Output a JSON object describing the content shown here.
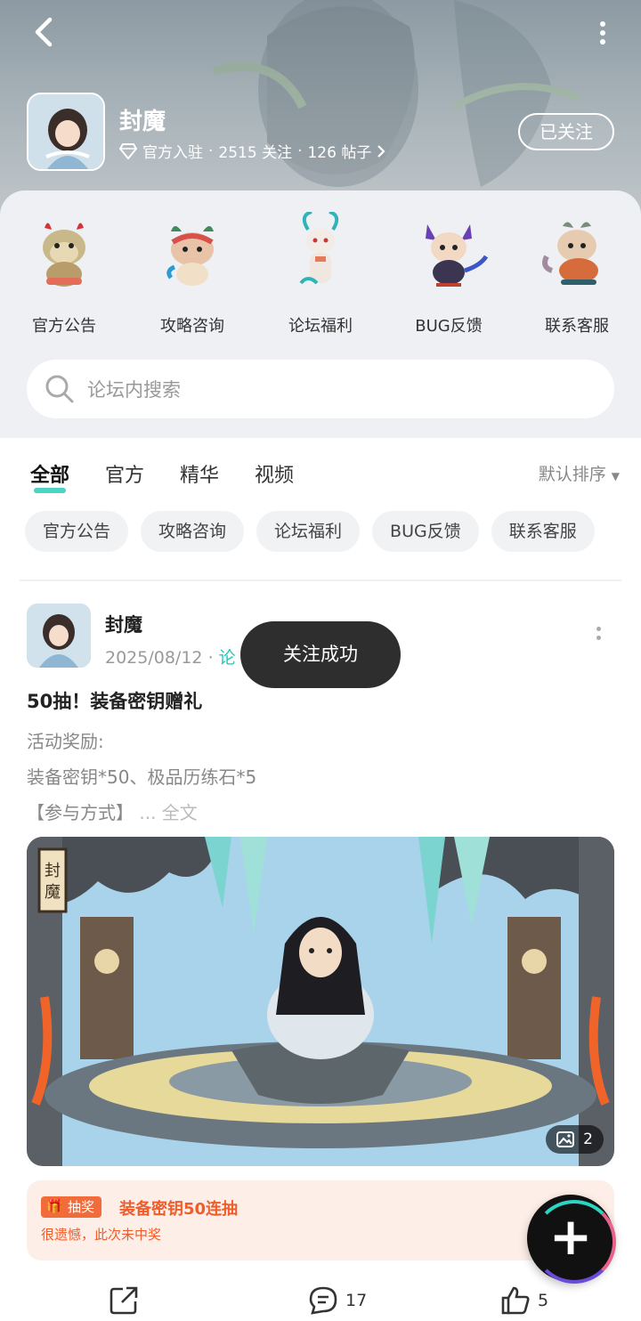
{
  "header": {
    "forum_name": "封魔",
    "official_label": "官方入驻",
    "follow_stats": "2515 关注",
    "post_stats": "126 帖子",
    "follow_button": "已关注"
  },
  "categories": [
    {
      "label": "官方公告"
    },
    {
      "label": "攻略咨询"
    },
    {
      "label": "论坛福利"
    },
    {
      "label": "BUG反馈"
    },
    {
      "label": "联系客服"
    }
  ],
  "search": {
    "placeholder": "论坛内搜索"
  },
  "tabs": [
    {
      "label": "全部",
      "active": true
    },
    {
      "label": "官方"
    },
    {
      "label": "精华"
    },
    {
      "label": "视频"
    }
  ],
  "sort_label": "默认排序",
  "chips": [
    "官方公告",
    "攻略咨询",
    "论坛福利",
    "BUG反馈",
    "联系客服"
  ],
  "post": {
    "author": "封魔",
    "date": "2025/08/12",
    "tag_prefix": "论",
    "title": "50抽！装备密钥赠礼",
    "lines": [
      "活动奖励:",
      "装备密钥*50、极品历练石*5",
      "【参与方式】"
    ],
    "expand_label": "... 全文",
    "image_count": "2",
    "image_banner_text": "封魔",
    "lottery": {
      "badge": "抽奖",
      "title": "装备密钥50连抽",
      "result": "很遗憾，此次未中奖"
    },
    "comments": "17",
    "likes": "5"
  },
  "toast": "关注成功",
  "colors": {
    "accent": "#1ec8b5",
    "lottery": "#f05d2a",
    "toast_bg": "#2e2e2e"
  }
}
